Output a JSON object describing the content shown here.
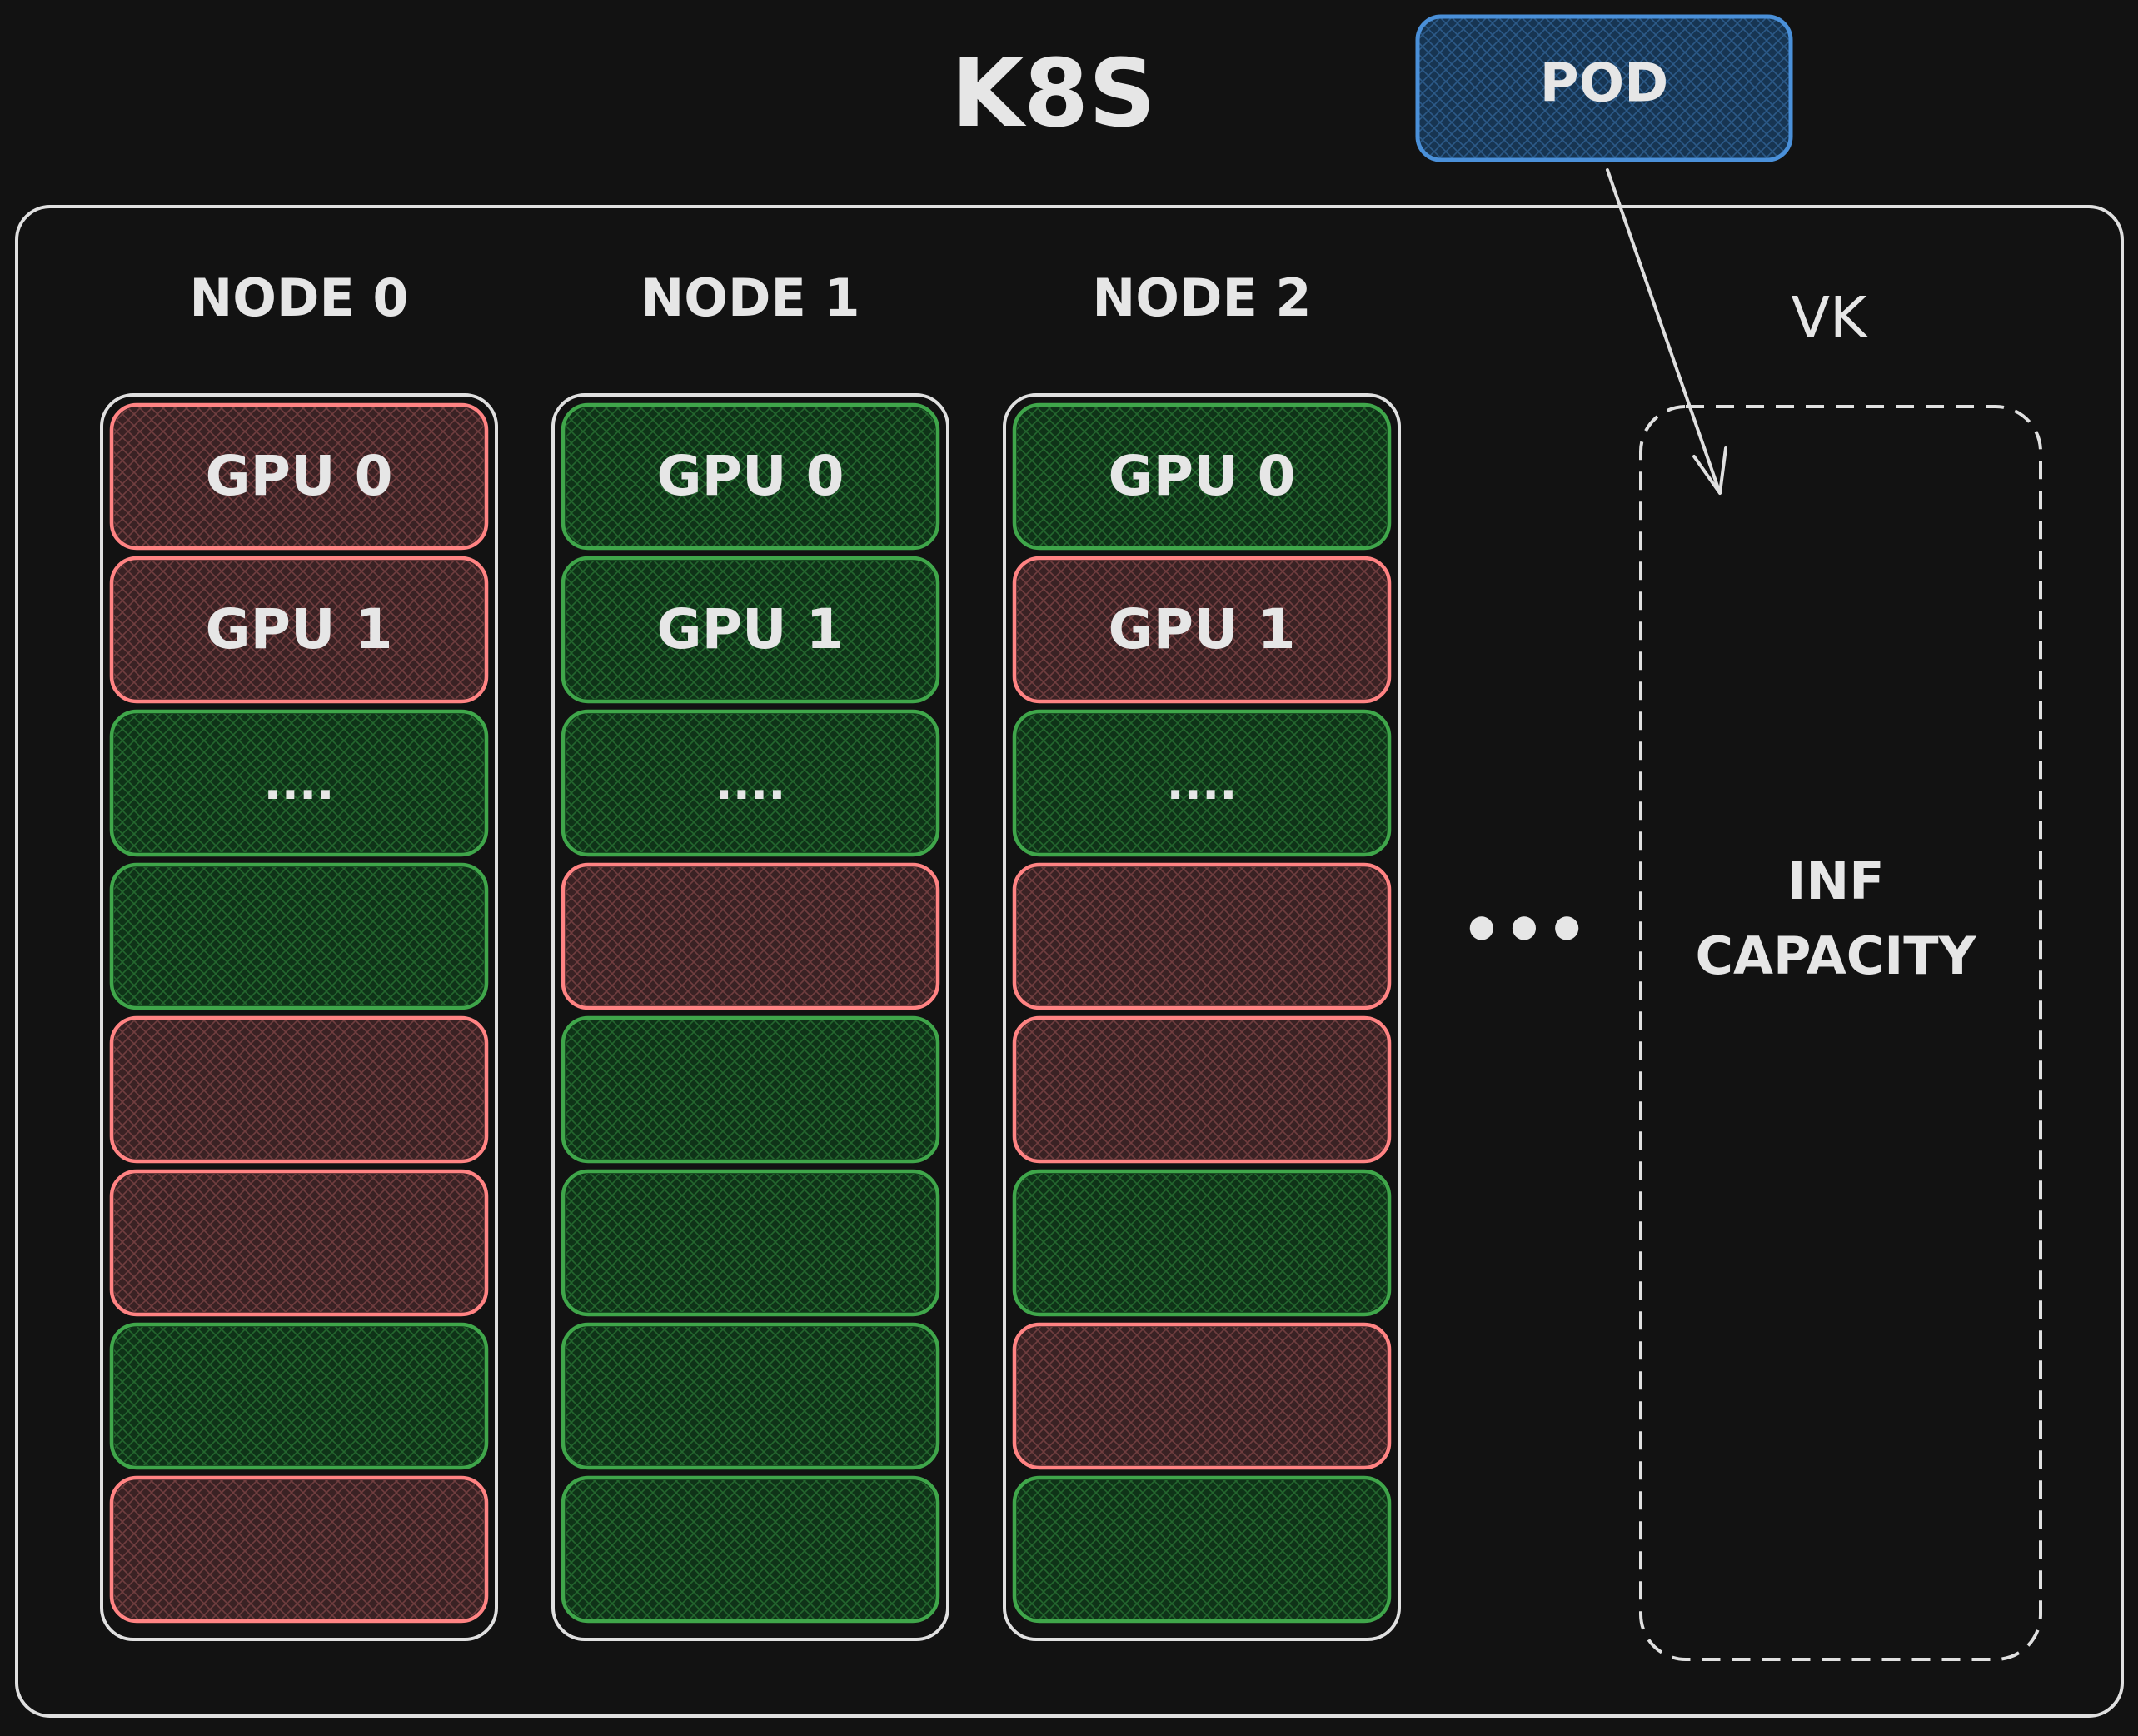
{
  "title": "K8S",
  "pod": {
    "label": "POD"
  },
  "nodes": [
    {
      "label": "NODE 0",
      "gpus": [
        {
          "label": "GPU 0",
          "state": "busy"
        },
        {
          "label": "GPU 1",
          "state": "busy"
        },
        {
          "label": "....",
          "state": "free"
        },
        {
          "label": "",
          "state": "free"
        },
        {
          "label": "",
          "state": "busy"
        },
        {
          "label": "",
          "state": "busy"
        },
        {
          "label": "",
          "state": "free"
        },
        {
          "label": "",
          "state": "busy"
        }
      ]
    },
    {
      "label": "NODE 1",
      "gpus": [
        {
          "label": "GPU 0",
          "state": "free"
        },
        {
          "label": "GPU 1",
          "state": "free"
        },
        {
          "label": "....",
          "state": "free"
        },
        {
          "label": "",
          "state": "busy"
        },
        {
          "label": "",
          "state": "free"
        },
        {
          "label": "",
          "state": "free"
        },
        {
          "label": "",
          "state": "free"
        },
        {
          "label": "",
          "state": "free"
        }
      ]
    },
    {
      "label": "NODE 2",
      "gpus": [
        {
          "label": "GPU 0",
          "state": "free"
        },
        {
          "label": "GPU 1",
          "state": "busy"
        },
        {
          "label": "....",
          "state": "free"
        },
        {
          "label": "",
          "state": "busy"
        },
        {
          "label": "",
          "state": "busy"
        },
        {
          "label": "",
          "state": "free"
        },
        {
          "label": "",
          "state": "busy"
        },
        {
          "label": "",
          "state": "free"
        }
      ]
    }
  ],
  "ellipsis": "•••",
  "vk": {
    "label": "VK",
    "capacity_line1": "INF",
    "capacity_line2": "CAPACITY"
  },
  "colors": {
    "background": "#121212",
    "outline": "#e0e0e0",
    "busy_stroke": "#ff8383",
    "busy_fill": "#3a2224",
    "free_stroke": "#3fa64a",
    "free_fill": "#0f3318",
    "pod_stroke": "#4a90d9",
    "pod_fill": "#173552"
  }
}
